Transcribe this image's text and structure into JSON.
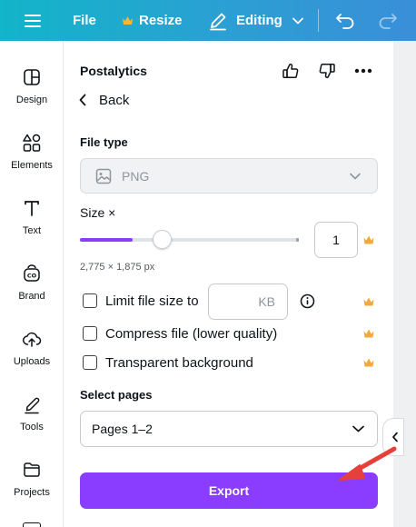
{
  "topbar": {
    "menu_icon": "hamburger-menu-icon",
    "file_label": "File",
    "resize_label": "Resize",
    "resize_icon": "crown-icon",
    "editing_label": "Editing",
    "editing_icon": "pencil-icon",
    "undo_icon": "undo-icon",
    "redo_icon": "redo-icon"
  },
  "rail": {
    "items": [
      {
        "label": "Design",
        "icon": "design-icon"
      },
      {
        "label": "Elements",
        "icon": "elements-icon"
      },
      {
        "label": "Text",
        "icon": "text-icon"
      },
      {
        "label": "Brand",
        "icon": "brand-icon"
      },
      {
        "label": "Uploads",
        "icon": "uploads-icon"
      },
      {
        "label": "Tools",
        "icon": "tools-icon"
      },
      {
        "label": "Projects",
        "icon": "projects-icon"
      }
    ]
  },
  "panel": {
    "title": "Postalytics",
    "back_label": "Back",
    "file_type_label": "File type",
    "file_type_value": "PNG",
    "size_label": "Size ×",
    "size_value": "1",
    "size_fraction": 0.2,
    "dimensions": "2,775 × 1,875 px",
    "limit_file_size_label": "Limit file size to",
    "limit_unit": "KB",
    "compress_label": "Compress file (lower quality)",
    "transparent_label": "Transparent background",
    "select_pages_label": "Select pages",
    "pages_value": "Pages 1–2",
    "export_label": "Export"
  },
  "colors": {
    "accent": "#8b3dff",
    "crown": "#f2a93b",
    "annotation_arrow": "#e5403a"
  }
}
